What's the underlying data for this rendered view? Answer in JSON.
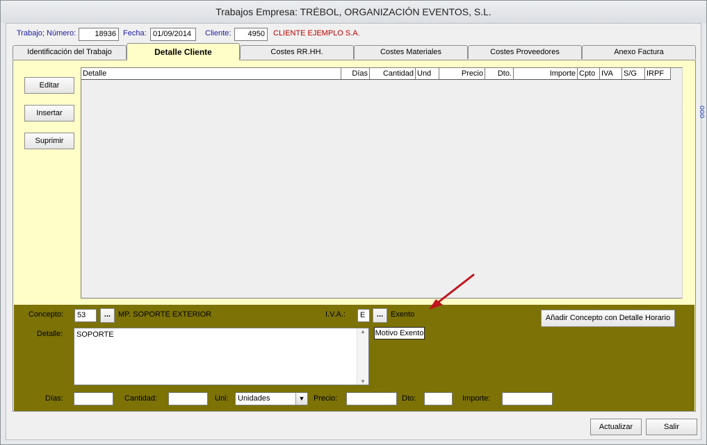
{
  "window": {
    "title": "Trabajos Empresa: TRÉBOL, ORGANIZACIÓN EVENTOS, S.L."
  },
  "header": {
    "trabajo_label": "Trabajo; Número:",
    "trabajo_value": "18936",
    "fecha_label": "Fecha:",
    "fecha_value": "01/09/2014",
    "cliente_label": "Cliente:",
    "cliente_value": "4950",
    "cliente_name": "CLIENTE EJEMPLO S.A."
  },
  "tabs": [
    {
      "label": "Identificación del Trabajo"
    },
    {
      "label": "Detalle Cliente"
    },
    {
      "label": "Costes RR.HH."
    },
    {
      "label": "Costes Materiales"
    },
    {
      "label": "Costes Proveedores"
    },
    {
      "label": "Anexo Factura"
    }
  ],
  "side_buttons": {
    "editar": "Editar",
    "insertar": "Insertar",
    "suprimir": "Suprimir"
  },
  "grid": {
    "columns": [
      "Detalle",
      "Días",
      "Cantidad",
      "Und",
      "Precio",
      "Dto.",
      "Importe",
      "Cpto",
      "IVA",
      "S/G",
      "IRPF"
    ],
    "rows": []
  },
  "form": {
    "concepto_label": "Concepto:",
    "concepto_value": "53",
    "concepto_button": "...",
    "concepto_desc": "MP. SOPORTE EXTERIOR",
    "iva_label": "I.V.A.:",
    "iva_value": "E",
    "iva_button": "...",
    "iva_desc": "Exento",
    "motivo_button": "Motivo Exento",
    "anadir_button": "Añadir Concepto con Detalle Horario",
    "detalle_label": "Detalle:",
    "detalle_value": "SOPORTE",
    "dias_label": "Días:",
    "cantidad_label": "Cantidad:",
    "uni_label": "Uni:",
    "uni_value": "Unidades",
    "precio_label": "Precio:",
    "dto_label": "Dto:",
    "importe_label": "Importe:"
  },
  "footer": {
    "actualizar": "Actualizar",
    "salir": "Salir"
  },
  "side_indicator": "ooo",
  "colors": {
    "panel_yellow": "#fffdc8",
    "olive": "#7c7205",
    "annotation_arrow": "#c0141e"
  }
}
